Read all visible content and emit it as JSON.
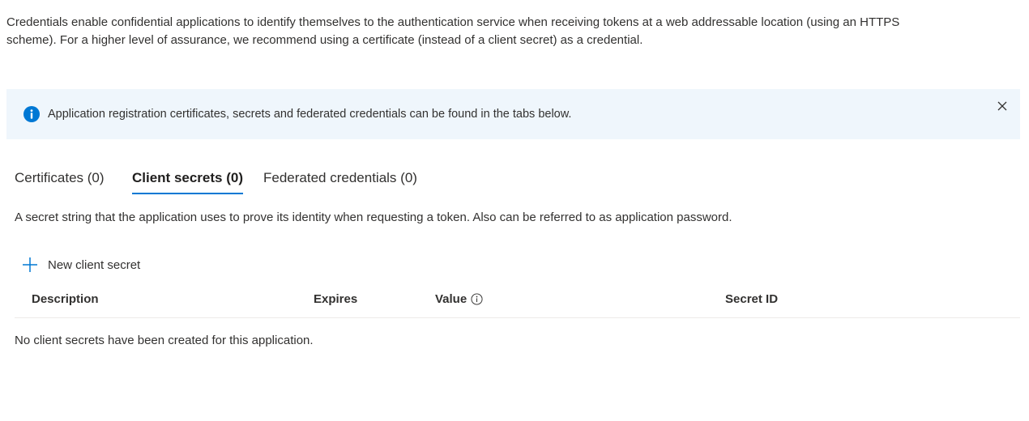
{
  "intro": {
    "line1": "Credentials enable confidential applications to identify themselves to the authentication service when receiving tokens at a web addressable location (using an HTTPS",
    "line2": "scheme). For a higher level of assurance, we recommend using a certificate (instead of a client secret) as a credential."
  },
  "info_bar": {
    "icon": "info-icon",
    "text": "Application registration certificates, secrets and federated credentials can be found in the tabs below.",
    "close_icon": "close-icon"
  },
  "tabs": [
    {
      "label": "Certificates (0)",
      "active": false
    },
    {
      "label": "Client secrets (0)",
      "active": true
    },
    {
      "label": "Federated credentials (0)",
      "active": false
    }
  ],
  "tab_description": "A secret string that the application uses to prove its identity when requesting a token. Also can be referred to as application password.",
  "actions": {
    "new_client_secret": "New client secret",
    "new_client_secret_icon": "plus-icon"
  },
  "table": {
    "columns": [
      "Description",
      "Expires",
      "Value",
      "Secret ID"
    ],
    "value_info_icon": "info-circle-icon",
    "empty_message": "No client secrets have been created for this application."
  },
  "colors": {
    "accent": "#0078d4",
    "info_background": "#eff6fc",
    "text": "#323130",
    "divider": "#edebe9"
  }
}
